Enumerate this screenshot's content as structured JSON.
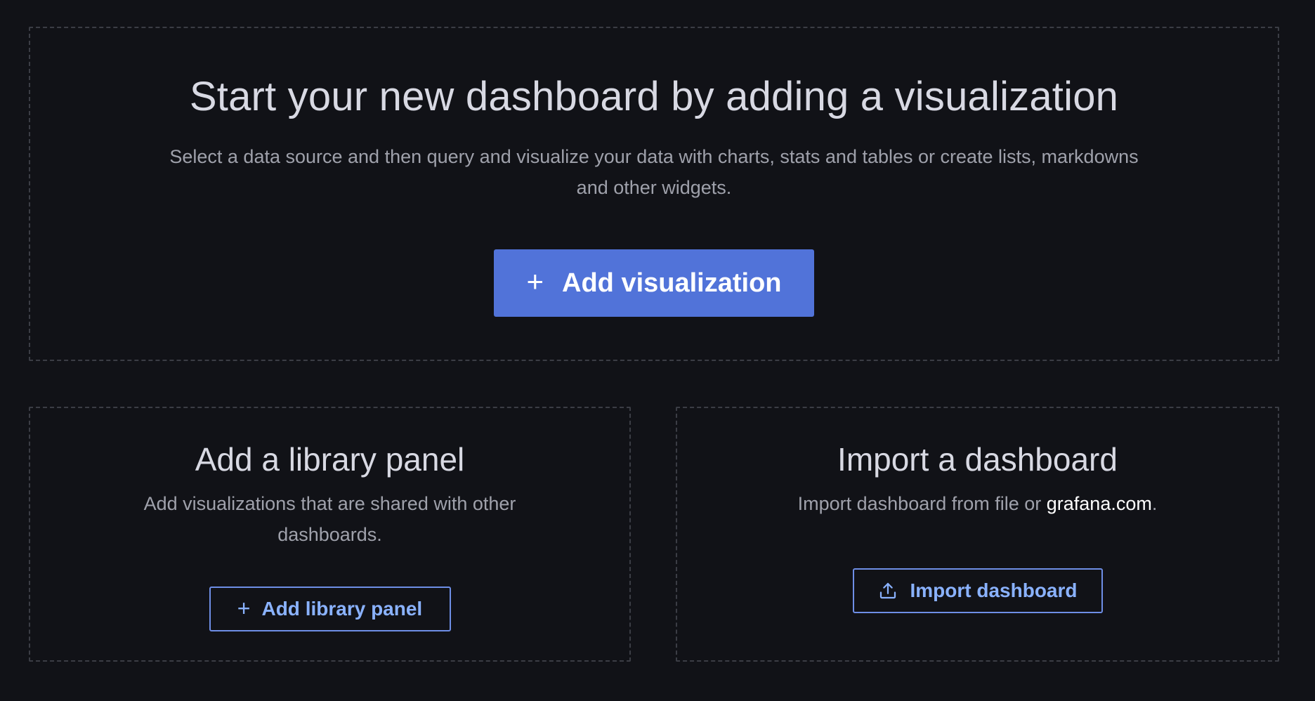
{
  "main_card": {
    "title": "Start your new dashboard by adding a visualization",
    "description": "Select a data source and then query and visualize your data with charts, stats and tables or create lists, markdowns and other widgets.",
    "button_label": "Add visualization",
    "button_icon": "plus-icon"
  },
  "library_card": {
    "title": "Add a library panel",
    "description": "Add visualizations that are shared with other dashboards.",
    "button_label": "Add library panel",
    "button_icon": "plus-icon"
  },
  "import_card": {
    "title": "Import a dashboard",
    "description_prefix": "Import dashboard from file or ",
    "description_link": "grafana.com",
    "description_suffix": ".",
    "button_label": "Import dashboard",
    "button_icon": "upload-icon"
  },
  "colors": {
    "background": "#111217",
    "primary_button": "#5173d9",
    "secondary_border": "#6e8ee6",
    "secondary_text": "#8ab2ff"
  }
}
